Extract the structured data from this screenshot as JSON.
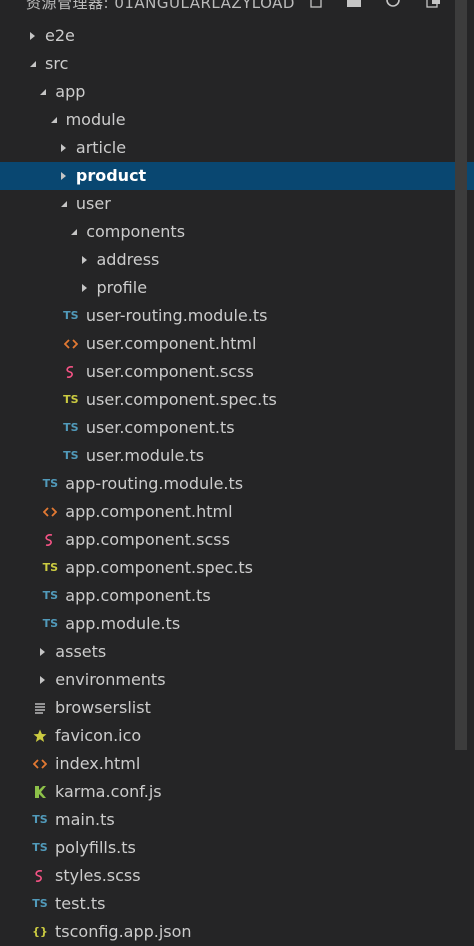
{
  "header": {
    "title": "资源管理器: 01ANGULARLAZYLOAD",
    "actions": [
      {
        "icon": "new-file-icon"
      },
      {
        "icon": "new-folder-icon"
      },
      {
        "icon": "refresh-icon"
      },
      {
        "icon": "collapse-all-icon"
      }
    ]
  },
  "colors": {
    "background": "#252526",
    "selection": "#094771",
    "ts": "#519aba",
    "ts_spec": "#cbcb41",
    "html": "#e37933",
    "scss": "#f55385",
    "favicon": "#cbcb41",
    "karma": "#8dc149"
  },
  "tree": [
    {
      "label": "e2e",
      "kind": "folder",
      "expanded": false,
      "depth": 0
    },
    {
      "label": "src",
      "kind": "folder",
      "expanded": true,
      "depth": 0
    },
    {
      "label": "app",
      "kind": "folder",
      "expanded": true,
      "depth": 1
    },
    {
      "label": "module",
      "kind": "folder",
      "expanded": true,
      "depth": 2
    },
    {
      "label": "article",
      "kind": "folder",
      "expanded": false,
      "depth": 3
    },
    {
      "label": "product",
      "kind": "folder",
      "expanded": false,
      "depth": 3,
      "selected": true
    },
    {
      "label": "user",
      "kind": "folder",
      "expanded": true,
      "depth": 3
    },
    {
      "label": "components",
      "kind": "folder",
      "expanded": true,
      "depth": 4
    },
    {
      "label": "address",
      "kind": "folder",
      "expanded": false,
      "depth": 5
    },
    {
      "label": "profile",
      "kind": "folder",
      "expanded": false,
      "depth": 5
    },
    {
      "label": "user-routing.module.ts",
      "kind": "file",
      "icon": "ts",
      "icon_text": "TS",
      "depth": 4
    },
    {
      "label": "user.component.html",
      "kind": "file",
      "icon": "html",
      "depth": 4
    },
    {
      "label": "user.component.scss",
      "kind": "file",
      "icon": "scss",
      "depth": 4
    },
    {
      "label": "user.component.spec.ts",
      "kind": "file",
      "icon": "ts_spec",
      "icon_text": "TS",
      "depth": 4
    },
    {
      "label": "user.component.ts",
      "kind": "file",
      "icon": "ts",
      "icon_text": "TS",
      "depth": 4
    },
    {
      "label": "user.module.ts",
      "kind": "file",
      "icon": "ts",
      "icon_text": "TS",
      "depth": 4
    },
    {
      "label": "app-routing.module.ts",
      "kind": "file",
      "icon": "ts",
      "icon_text": "TS",
      "depth": 2
    },
    {
      "label": "app.component.html",
      "kind": "file",
      "icon": "html",
      "depth": 2
    },
    {
      "label": "app.component.scss",
      "kind": "file",
      "icon": "scss",
      "depth": 2
    },
    {
      "label": "app.component.spec.ts",
      "kind": "file",
      "icon": "ts_spec",
      "icon_text": "TS",
      "depth": 2
    },
    {
      "label": "app.component.ts",
      "kind": "file",
      "icon": "ts",
      "icon_text": "TS",
      "depth": 2
    },
    {
      "label": "app.module.ts",
      "kind": "file",
      "icon": "ts",
      "icon_text": "TS",
      "depth": 2
    },
    {
      "label": "assets",
      "kind": "folder",
      "expanded": false,
      "depth": 1
    },
    {
      "label": "environments",
      "kind": "folder",
      "expanded": false,
      "depth": 1
    },
    {
      "label": "browserslist",
      "kind": "file",
      "icon": "lines",
      "depth": 1
    },
    {
      "label": "favicon.ico",
      "kind": "file",
      "icon": "star",
      "depth": 1
    },
    {
      "label": "index.html",
      "kind": "file",
      "icon": "html",
      "depth": 1
    },
    {
      "label": "karma.conf.js",
      "kind": "file",
      "icon": "karma",
      "depth": 1
    },
    {
      "label": "main.ts",
      "kind": "file",
      "icon": "ts",
      "icon_text": "TS",
      "depth": 1
    },
    {
      "label": "polyfills.ts",
      "kind": "file",
      "icon": "ts",
      "icon_text": "TS",
      "depth": 1
    },
    {
      "label": "styles.scss",
      "kind": "file",
      "icon": "scss",
      "depth": 1
    },
    {
      "label": "test.ts",
      "kind": "file",
      "icon": "ts",
      "icon_text": "TS",
      "depth": 1
    },
    {
      "label": "tsconfig.app.json",
      "kind": "file",
      "icon": "json",
      "icon_text": "{}",
      "depth": 1
    }
  ]
}
